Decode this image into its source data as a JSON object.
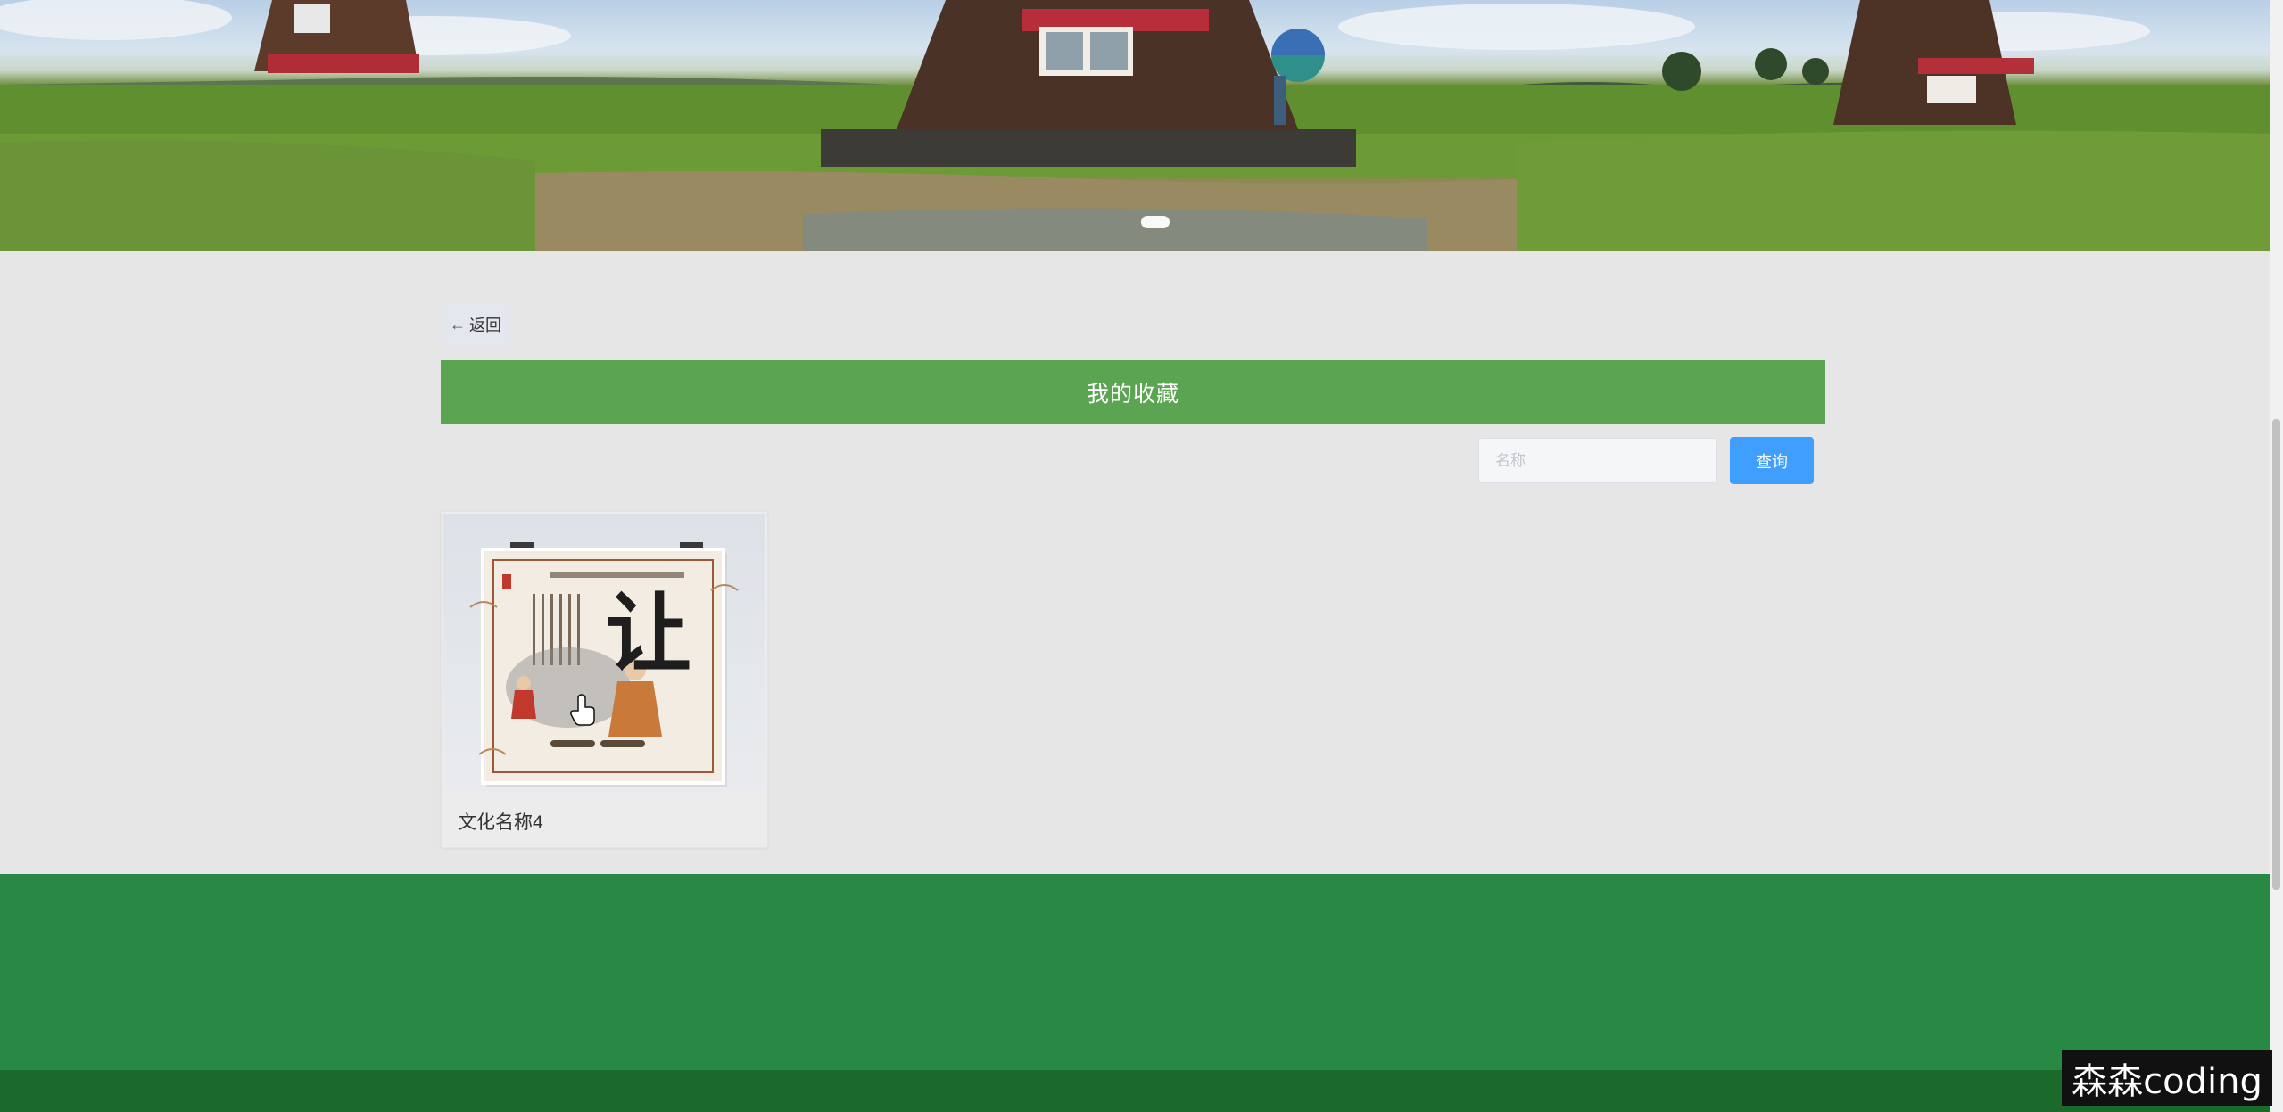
{
  "banner": {
    "image_description_icon": "windmill-landscape-image",
    "active_slide_indicator": "carousel-dot"
  },
  "nav": {
    "back_label": "返回",
    "back_icon": "arrow-left-icon"
  },
  "page": {
    "title": "我的收藏"
  },
  "search": {
    "placeholder": "名称",
    "value": "",
    "button_label": "查询"
  },
  "favorites": [
    {
      "name": "文化名称4",
      "poster_character": "让"
    }
  ],
  "watermark": {
    "text": "森森coding"
  },
  "colors": {
    "title_bar": "#5ba452",
    "search_button": "#409eff",
    "footer": "#288944",
    "footer_bottom": "#1c6a2b",
    "page_background": "#e6e6e6"
  }
}
